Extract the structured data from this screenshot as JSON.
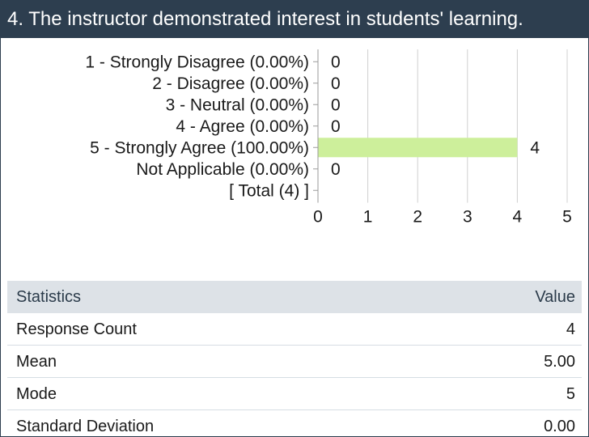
{
  "question": {
    "title": "4. The instructor demonstrated interest in students' learning."
  },
  "colors": {
    "header_bg": "#2d3e4f",
    "bar_fill": "#cdef9b",
    "grid": "#d0d0d0",
    "stats_header_bg": "#dde2e7"
  },
  "chart_data": {
    "type": "bar",
    "orientation": "horizontal",
    "categories": [
      "1 - Strongly Disagree (0.00%)",
      "2 - Disagree (0.00%)",
      "3 - Neutral (0.00%)",
      "4 - Agree (0.00%)",
      "5 - Strongly Agree (100.00%)",
      "Not Applicable (0.00%)",
      "[ Total (4) ]"
    ],
    "values": [
      0,
      0,
      0,
      0,
      4,
      0,
      null
    ],
    "data_labels": [
      "0",
      "0",
      "0",
      "0",
      "4",
      "0",
      ""
    ],
    "xlim": [
      0,
      5
    ],
    "xticks": [
      "0",
      "1",
      "2",
      "3",
      "4",
      "5"
    ],
    "grid": true
  },
  "statistics": {
    "header": {
      "label": "Statistics",
      "value": "Value"
    },
    "rows": [
      {
        "label": "Response Count",
        "value": "4"
      },
      {
        "label": "Mean",
        "value": "5.00"
      },
      {
        "label": "Mode",
        "value": "5"
      },
      {
        "label": "Standard Deviation",
        "value": "0.00"
      }
    ]
  }
}
